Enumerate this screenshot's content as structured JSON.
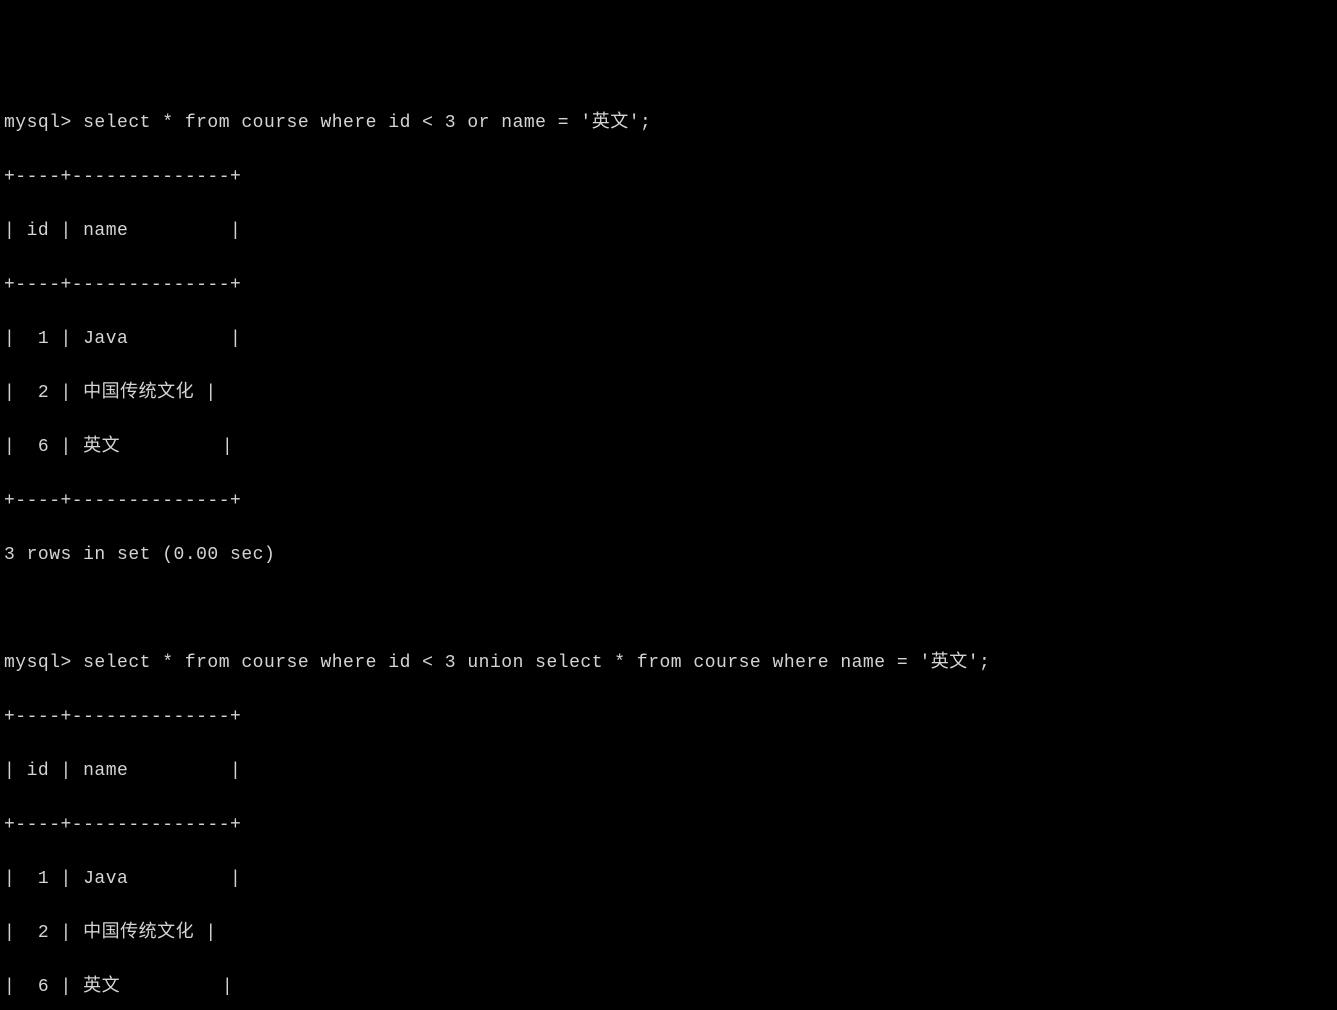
{
  "prompt": "mysql>",
  "queries": [
    {
      "sql": " select * from course where id < 3 or name = '英文';",
      "table": {
        "columns": [
          "id",
          "name"
        ],
        "rows": [
          {
            "id": "1",
            "name": "Java"
          },
          {
            "id": "2",
            "name": "中国传统文化"
          },
          {
            "id": "6",
            "name": "英文"
          }
        ]
      },
      "status": "3 rows in set (0.00 sec)"
    },
    {
      "sql": " select * from course where id < 3 union select * from course where name = '英文';",
      "table": {
        "columns": [
          "id",
          "name"
        ],
        "rows": [
          {
            "id": "1",
            "name": "Java"
          },
          {
            "id": "2",
            "name": "中国传统文化"
          },
          {
            "id": "6",
            "name": "英文"
          }
        ]
      },
      "status": ""
    }
  ],
  "border_top": "+----+--------------+",
  "header_line": "| id | name         |",
  "row_templates": {
    "java": "|  1 | Java         |",
    "cn": "|  2 | 中国传统文化 |",
    "en": "|  6 | 英文         |"
  }
}
